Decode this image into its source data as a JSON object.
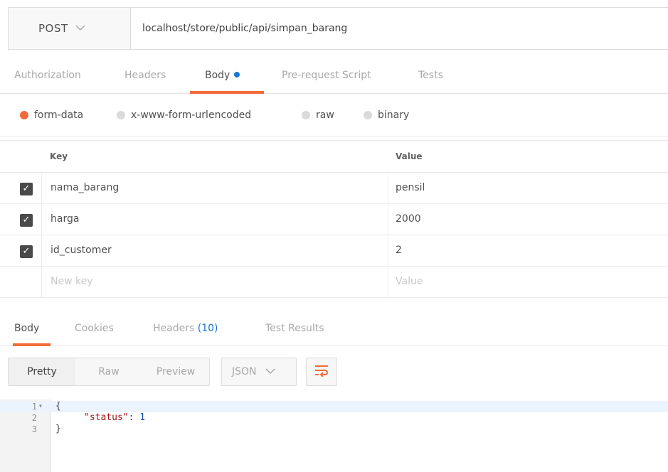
{
  "request": {
    "method": "POST",
    "url": "localhost/store/public/api/simpan_barang"
  },
  "request_tabs": [
    {
      "label": "Authorization"
    },
    {
      "label": "Headers"
    },
    {
      "label": "Body"
    },
    {
      "label": "Pre-request Script"
    },
    {
      "label": "Tests"
    }
  ],
  "body_types": [
    {
      "label": "form-data",
      "selected": true
    },
    {
      "label": "x-www-form-urlencoded",
      "selected": false
    },
    {
      "label": "raw",
      "selected": false
    },
    {
      "label": "binary",
      "selected": false
    }
  ],
  "kv_table": {
    "headers": {
      "key": "Key",
      "value": "Value"
    },
    "rows": [
      {
        "key": "nama_barang",
        "value": "pensil",
        "checked": true
      },
      {
        "key": "harga",
        "value": "2000",
        "checked": true
      },
      {
        "key": "id_customer",
        "value": "2",
        "checked": true
      }
    ],
    "new_row": {
      "key_placeholder": "New key",
      "value_placeholder": "Value"
    }
  },
  "response_tabs": [
    {
      "label": "Body"
    },
    {
      "label": "Cookies"
    },
    {
      "label": "Headers",
      "count": "(10)"
    },
    {
      "label": "Test Results"
    }
  ],
  "format_buttons": [
    {
      "label": "Pretty"
    },
    {
      "label": "Raw"
    },
    {
      "label": "Preview"
    }
  ],
  "format_select": {
    "value": "JSON"
  },
  "code": {
    "lines": [
      {
        "num": "1",
        "text": "{"
      },
      {
        "num": "2",
        "key": "\"status\"",
        "sep": ": ",
        "value": "1"
      },
      {
        "num": "3",
        "text": "}"
      }
    ]
  },
  "colors": {
    "accent": "#f26b3a",
    "blue": "#1976d2"
  }
}
